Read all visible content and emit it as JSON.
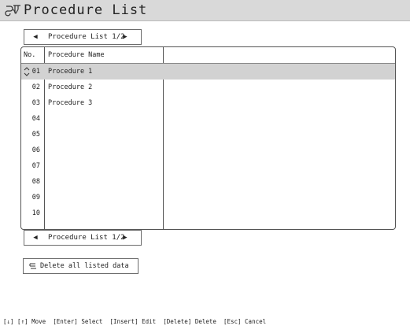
{
  "window": {
    "title": "Procedure List"
  },
  "pager_top": {
    "prev_icon": "◀",
    "label": "Procedure List 1/2",
    "next_icon": "▶"
  },
  "table": {
    "header_no": "No.",
    "header_name": "Procedure Name",
    "rows": [
      {
        "no": "01",
        "name": "Procedure 1"
      },
      {
        "no": "02",
        "name": "Procedure 2"
      },
      {
        "no": "03",
        "name": "Procedure 3"
      },
      {
        "no": "04",
        "name": ""
      },
      {
        "no": "05",
        "name": ""
      },
      {
        "no": "06",
        "name": ""
      },
      {
        "no": "07",
        "name": ""
      },
      {
        "no": "08",
        "name": ""
      },
      {
        "no": "09",
        "name": ""
      },
      {
        "no": "10",
        "name": ""
      }
    ],
    "selected_row": "01"
  },
  "pager_bottom": {
    "prev_icon": "◀",
    "label": "Procedure List 1/2",
    "next_icon": "▶"
  },
  "delete_all": {
    "label": "Delete all listed data"
  },
  "status": {
    "text": "[↓] [↑] Move  [Enter] Select  [Insert] Edit  [Delete] Delete  [Esc] Cancel"
  },
  "colors": {
    "titlebar": "#d9d9d9",
    "selected_row": "#d2d2d2",
    "border": "#555555"
  }
}
